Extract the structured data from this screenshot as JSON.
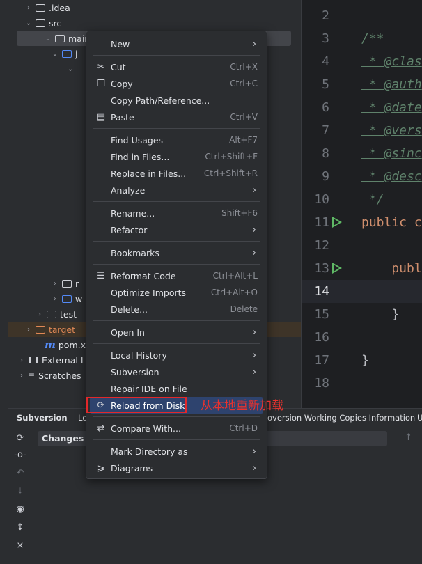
{
  "tree": {
    "rows": [
      {
        "label": ".idea"
      },
      {
        "label": "src"
      },
      {
        "label": "main"
      },
      {
        "label": "j"
      },
      {
        "label": ""
      },
      {
        "label": "r"
      },
      {
        "label": "w"
      },
      {
        "label": "test"
      },
      {
        "label": "target"
      },
      {
        "label": "pom.xml"
      },
      {
        "label": "External Libraries"
      },
      {
        "label": "Scratches"
      }
    ]
  },
  "editor": {
    "lines": [
      {
        "num": "2",
        "code": ""
      },
      {
        "num": "3",
        "code": "/**"
      },
      {
        "num": "4",
        "tag": " * @clas"
      },
      {
        "num": "5",
        "tag": " * @auth"
      },
      {
        "num": "6",
        "tag": " * @date"
      },
      {
        "num": "7",
        "tag": " * @vers"
      },
      {
        "num": "8",
        "tag": " * @sinc"
      },
      {
        "num": "9",
        "tag": " * @desc"
      },
      {
        "num": "10",
        "code": " */"
      },
      {
        "num": "11",
        "kw": "public c"
      },
      {
        "num": "12",
        "code": ""
      },
      {
        "num": "13",
        "kw": "    publ"
      },
      {
        "num": "14",
        "code": ""
      },
      {
        "num": "15",
        "code": "    }"
      },
      {
        "num": "16",
        "code": ""
      },
      {
        "num": "17",
        "code": "}"
      },
      {
        "num": "18",
        "code": ""
      }
    ]
  },
  "menu": {
    "items": [
      {
        "label": "New",
        "shortcut": "",
        "icon": "",
        "submenu": true
      },
      {
        "label": "Cut",
        "shortcut": "Ctrl+X",
        "icon": "scissors-icon",
        "submenu": false
      },
      {
        "label": "Copy",
        "shortcut": "Ctrl+C",
        "icon": "copy-icon",
        "submenu": false
      },
      {
        "label": "Copy Path/Reference...",
        "shortcut": "",
        "icon": "",
        "submenu": false
      },
      {
        "label": "Paste",
        "shortcut": "Ctrl+V",
        "icon": "paste-icon",
        "submenu": false
      },
      {
        "label": "Find Usages",
        "shortcut": "Alt+F7",
        "icon": "",
        "submenu": false
      },
      {
        "label": "Find in Files...",
        "shortcut": "Ctrl+Shift+F",
        "icon": "",
        "submenu": false
      },
      {
        "label": "Replace in Files...",
        "shortcut": "Ctrl+Shift+R",
        "icon": "",
        "submenu": false
      },
      {
        "label": "Analyze",
        "shortcut": "",
        "icon": "",
        "submenu": true
      },
      {
        "label": "Rename...",
        "shortcut": "Shift+F6",
        "icon": "",
        "submenu": false
      },
      {
        "label": "Refactor",
        "shortcut": "",
        "icon": "",
        "submenu": true
      },
      {
        "label": "Bookmarks",
        "shortcut": "",
        "icon": "",
        "submenu": true
      },
      {
        "label": "Reformat Code",
        "shortcut": "Ctrl+Alt+L",
        "icon": "reformat-icon",
        "submenu": false
      },
      {
        "label": "Optimize Imports",
        "shortcut": "Ctrl+Alt+O",
        "icon": "",
        "submenu": false
      },
      {
        "label": "Delete...",
        "shortcut": "Delete",
        "icon": "",
        "submenu": false
      },
      {
        "label": "Open In",
        "shortcut": "",
        "icon": "",
        "submenu": true
      },
      {
        "label": "Local History",
        "shortcut": "",
        "icon": "",
        "submenu": true
      },
      {
        "label": "Subversion",
        "shortcut": "",
        "icon": "",
        "submenu": true
      },
      {
        "label": "Repair IDE on File",
        "shortcut": "",
        "icon": "",
        "submenu": false
      },
      {
        "label": "Reload from Disk",
        "shortcut": "",
        "icon": "reload-icon",
        "submenu": false
      },
      {
        "label": "Compare With...",
        "shortcut": "Ctrl+D",
        "icon": "compare-icon",
        "submenu": false
      },
      {
        "label": "Mark Directory as",
        "shortcut": "",
        "icon": "",
        "submenu": true
      },
      {
        "label": "Diagrams",
        "shortcut": "",
        "icon": "diagram-icon",
        "submenu": true
      }
    ]
  },
  "annotation": "从本地重新加载",
  "bottom": {
    "tabs": [
      "Subversion",
      "Lo",
      "oversion Working Copies Information",
      "U"
    ],
    "changes_label": "Changes"
  },
  "colors": {
    "highlight": "#2e436e",
    "annotation_red": "#e2282a",
    "run_green": "#5fb865",
    "folder_blue": "#548af7",
    "target_orange": "#e08855"
  }
}
